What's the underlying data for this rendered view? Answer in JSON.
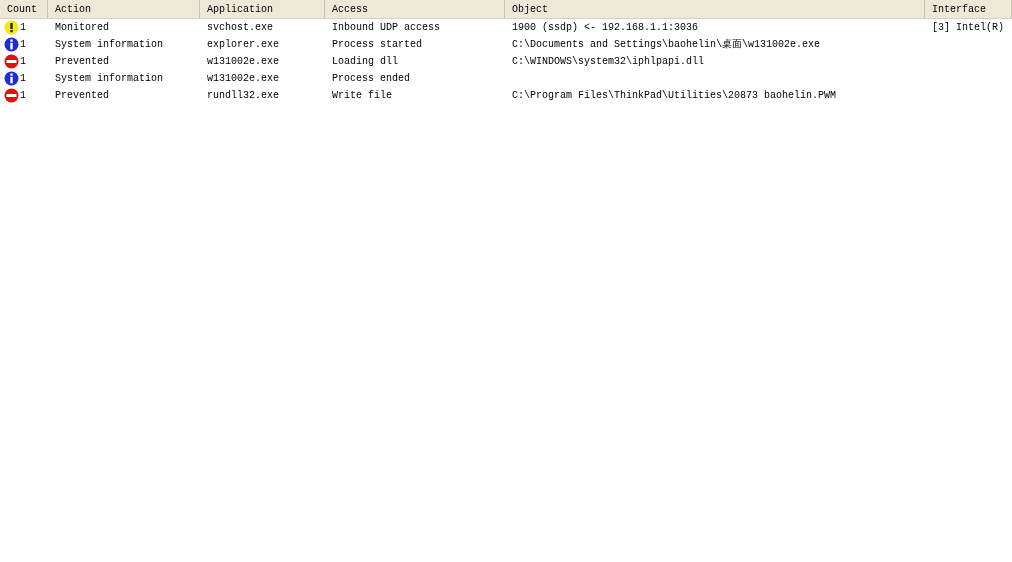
{
  "table": {
    "columns": [
      "Count",
      "Action",
      "Application",
      "Access",
      "Object",
      "Interface"
    ],
    "rows": [
      {
        "kind": "warning",
        "count": "1",
        "action": "Monitored",
        "application": "svchost.exe",
        "access": "Inbound UDP access",
        "object": "1900 (ssdp) <- 192.168.1.1:3036",
        "interface": "[3] Intel(R)"
      },
      {
        "kind": "info",
        "count": "1",
        "action": "System information",
        "application": "explorer.exe",
        "access": "Process started",
        "object": "C:\\Documents and Settings\\baohelin\\桌面\\w131002e.exe"
      },
      {
        "kind": "prevented",
        "count": "1",
        "action": "Prevented",
        "application": "w131002e.exe",
        "access": "Loading dll",
        "object": "C:\\WINDOWS\\system32\\iphlpapi.dll"
      },
      {
        "kind": "info",
        "count": "1",
        "action": "System information",
        "application": "w131002e.exe",
        "access": "Process ended"
      },
      {
        "kind": "prevented",
        "count": "1",
        "action": "Prevented",
        "application": "rundll32.exe",
        "access": "Write file",
        "object": "C:\\Program Files\\ThinkPad\\Utilities\\20873 baohelin.PWM"
      }
    ]
  }
}
